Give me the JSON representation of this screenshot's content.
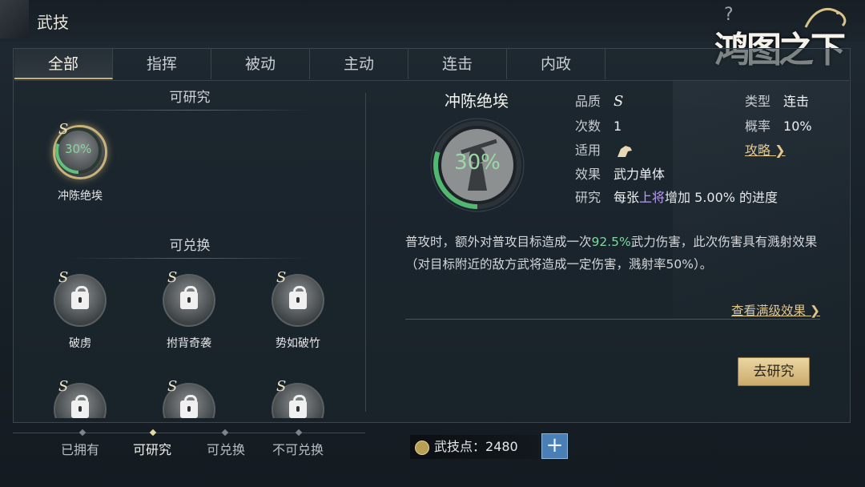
{
  "header": {
    "title": "武技",
    "help": "?",
    "brand": "鸿图之下"
  },
  "tabs": [
    {
      "label": "全部",
      "active": true
    },
    {
      "label": "指挥",
      "active": false
    },
    {
      "label": "被动",
      "active": false
    },
    {
      "label": "主动",
      "active": false
    },
    {
      "label": "连击",
      "active": false
    },
    {
      "label": "内政",
      "active": false
    }
  ],
  "left": {
    "researchable_title": "可研究",
    "exchangeable_title": "可兑换",
    "researchable": [
      {
        "name": "冲陈绝埃",
        "grade": "S",
        "progress_label": "30%",
        "progress": 0.3
      }
    ],
    "exchangeable": [
      {
        "name": "破虏",
        "grade": "S"
      },
      {
        "name": "拊背奇袭",
        "grade": "S"
      },
      {
        "name": "势如破竹",
        "grade": "S"
      },
      {
        "name": "",
        "grade": "S"
      },
      {
        "name": "",
        "grade": "S"
      },
      {
        "name": "",
        "grade": "S"
      }
    ]
  },
  "detail": {
    "name": "冲陈绝埃",
    "progress_label": "30%",
    "progress": 0.3,
    "labels": {
      "quality": "品质",
      "count": "次数",
      "applies": "适用",
      "effect": "效果",
      "research": "研究",
      "type": "类型",
      "rate": "概率"
    },
    "quality": "S",
    "count": "1",
    "effect": "武力单体",
    "research_prefix": "每张",
    "research_highlight": "上将",
    "research_suffix": "增加 5.00% 的进度",
    "type": "连击",
    "rate": "10%",
    "guide": "攻略",
    "description_1": "普攻时，额外对普攻目标造成一次",
    "description_highlight": "92.5%",
    "description_2": "武力伤害，此次伤害具有溅射效果（对目标附近的敌方武将造成一定伤害，溅射率50%）。",
    "full_effect_link": "查看满级效果",
    "research_button": "去研究"
  },
  "filters": [
    {
      "label": "已拥有",
      "active": false
    },
    {
      "label": "可研究",
      "active": true
    },
    {
      "label": "可兑换",
      "active": false
    },
    {
      "label": "不可兑换",
      "active": false
    }
  ],
  "points": {
    "label": "武技点：",
    "value": "2480",
    "plus": "+"
  },
  "colors": {
    "accent_gold": "#e3c98f",
    "progress_green": "#7fd6a0",
    "highlight_purple": "#b79cf0"
  }
}
